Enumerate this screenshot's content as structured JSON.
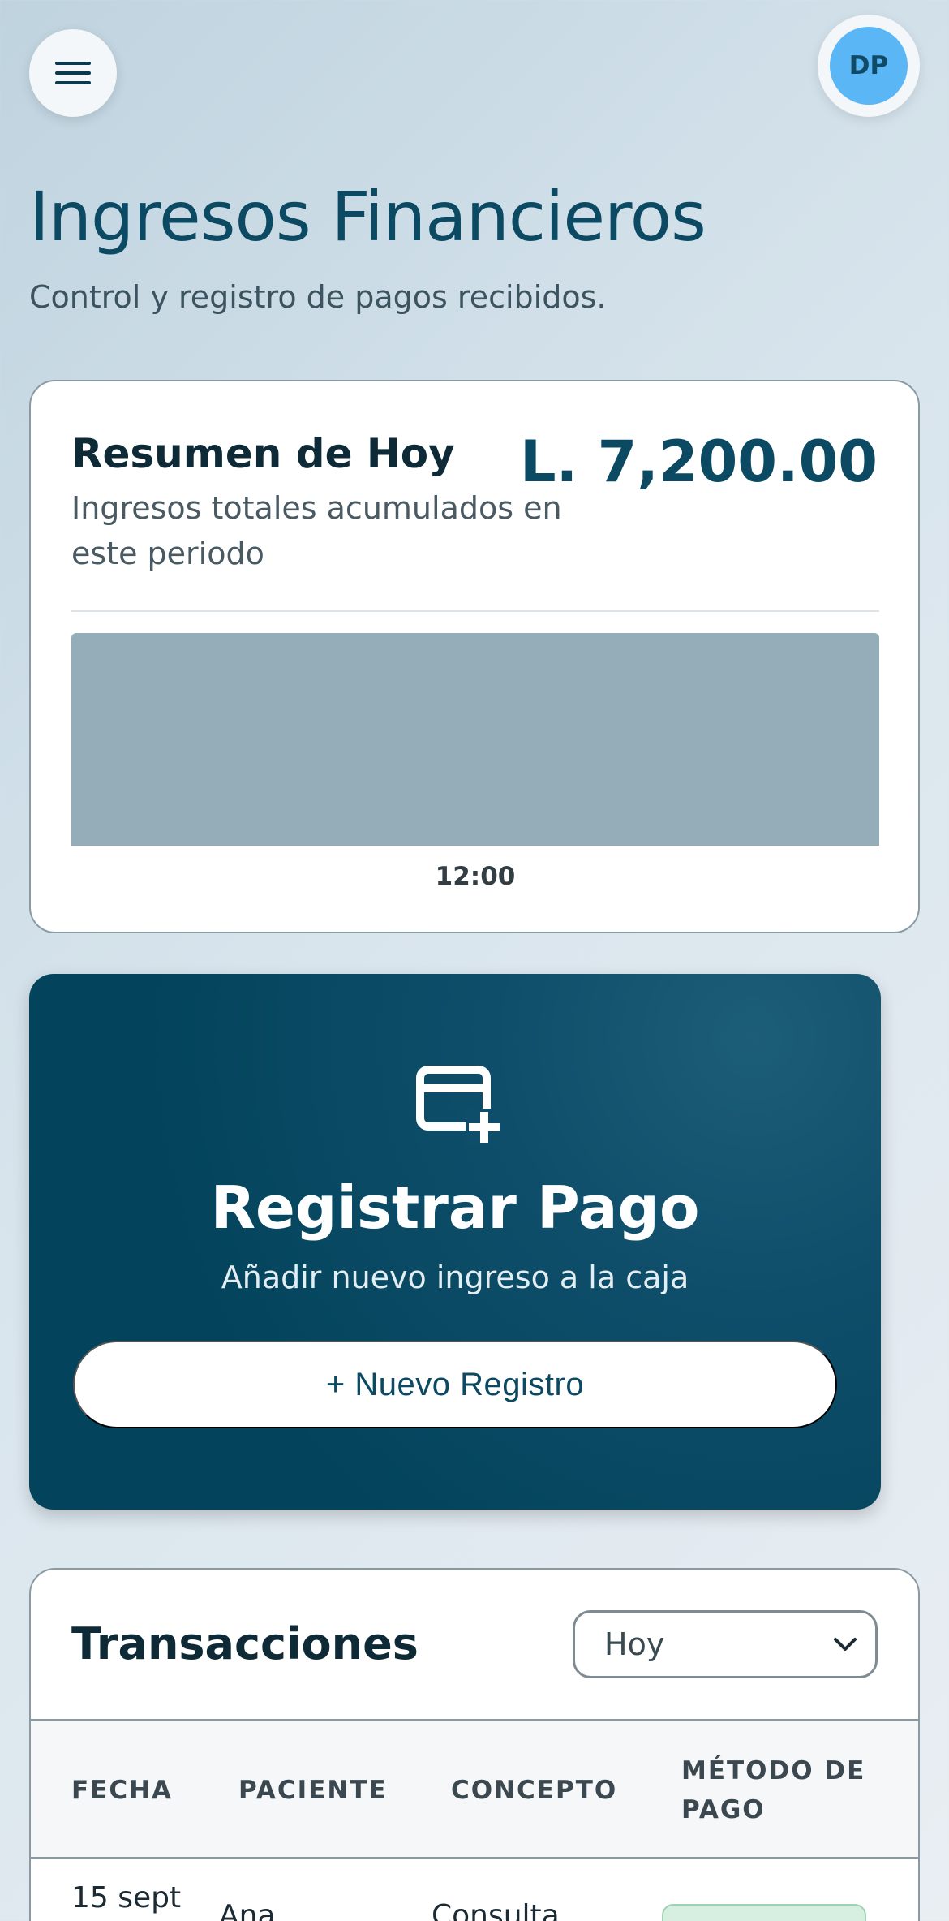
{
  "header": {
    "avatar_initials": "DP",
    "title": "Ingresos Financieros",
    "subtitle": "Control y registro de pagos recibidos."
  },
  "summary": {
    "title": "Resumen de Hoy",
    "description": "Ingresos totales acumulados en este periodo",
    "amount": "L. 7,200.00"
  },
  "chart_data": {
    "type": "bar",
    "categories": [
      "12:00"
    ],
    "values": [
      7200
    ],
    "ylim": [
      0,
      7200
    ],
    "grid": false,
    "bar_color": "#94adb8"
  },
  "register": {
    "title": "Registrar Pago",
    "subtitle": "Añadir nuevo ingreso a la caja",
    "button_label": "+ Nuevo Registro"
  },
  "transactions": {
    "title": "Transacciones",
    "filter_value": "Hoy",
    "columns": [
      "FECHA",
      "PACIENTE",
      "CONCEPTO",
      "MÉTODO DE PAGO"
    ],
    "rows": [
      {
        "fecha": "15 sept",
        "paciente": "Ana",
        "concepto": "Consulta"
      }
    ]
  },
  "colors": {
    "primary": "#0b4a62",
    "avatar": "#5bb6f6",
    "badge": "#d6efe1"
  }
}
